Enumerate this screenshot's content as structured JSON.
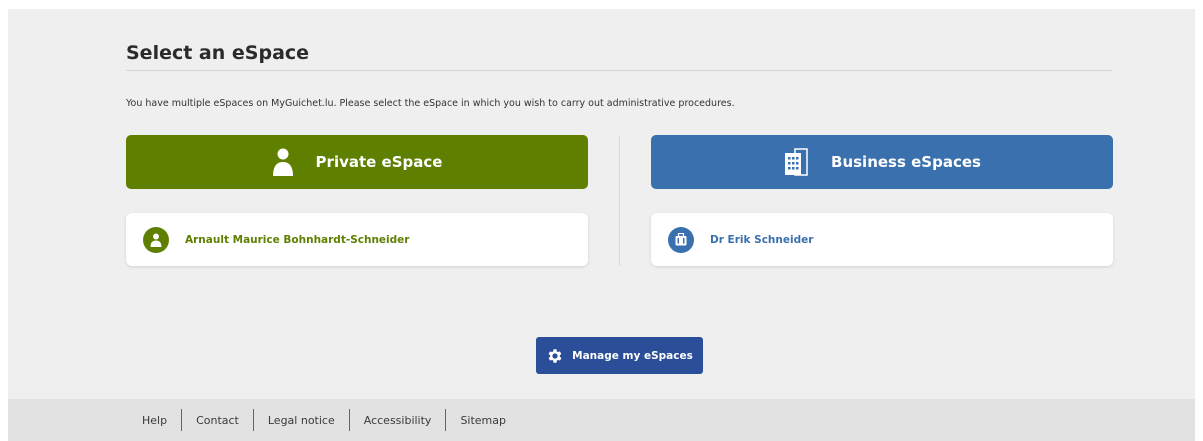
{
  "page": {
    "title": "Select an eSpace",
    "intro": "You have multiple eSpaces on MyGuichet.lu. Please select the eSpace in which you wish to carry out administrative procedures."
  },
  "private": {
    "button_label": "Private eSpace",
    "button_icon": "person-icon",
    "account_name": "Arnault Maurice Bohnhardt-Schneider",
    "account_icon": "person-icon",
    "color": "#5e7f00"
  },
  "business": {
    "button_label": "Business eSpaces",
    "button_icon": "building-icon",
    "account_name": "Dr Erik Schneider",
    "account_icon": "briefcase-icon",
    "color": "#3a70ad"
  },
  "manage": {
    "label": "Manage my eSpaces",
    "icon": "gear-icon",
    "color": "#2b4e98"
  },
  "footer": {
    "links": [
      "Help",
      "Contact",
      "Legal notice",
      "Accessibility",
      "Sitemap"
    ]
  }
}
